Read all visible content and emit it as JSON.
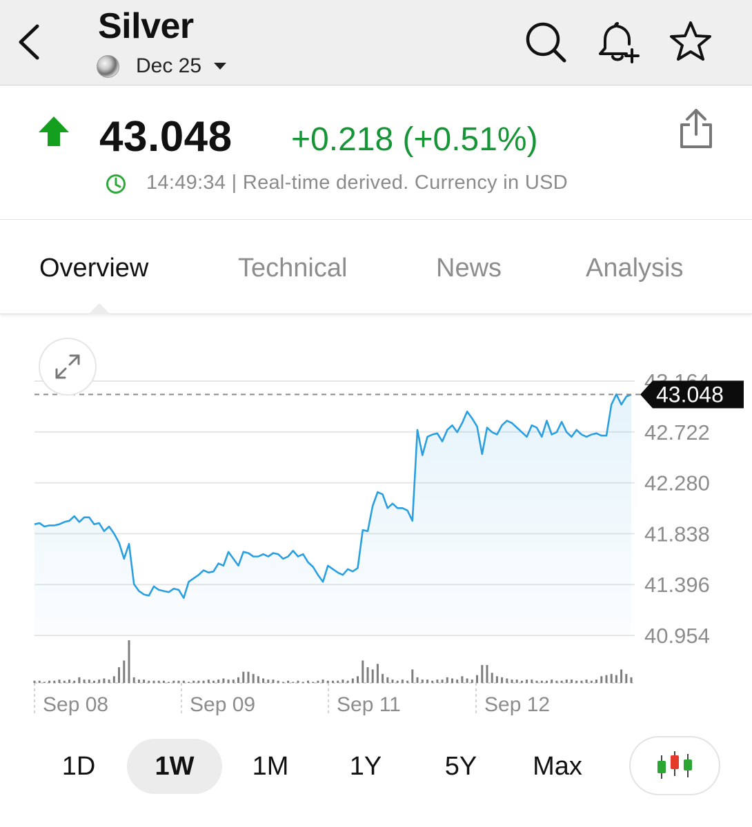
{
  "header": {
    "title": "Silver",
    "contract_label": "Dec 25"
  },
  "quote": {
    "price": "43.048",
    "change": "+0.218 (+0.51%)",
    "status": "14:49:34 | Real-time derived. Currency in USD",
    "change_color": "#159536"
  },
  "tabs": [
    {
      "label": "Overview"
    },
    {
      "label": "Technical"
    },
    {
      "label": "News"
    },
    {
      "label": "Analysis"
    }
  ],
  "ranges": [
    {
      "label": "1D"
    },
    {
      "label": "1W"
    },
    {
      "label": "1M"
    },
    {
      "label": "1Y"
    },
    {
      "label": "5Y"
    },
    {
      "label": "Max"
    }
  ],
  "icons": [
    "chevron-left-icon",
    "search-icon",
    "bell-plus-icon",
    "star-icon",
    "share-icon",
    "clock-icon",
    "expand-icon",
    "candlestick-icon"
  ],
  "chart_data": {
    "type": "area",
    "line_color": "#2a9fe0",
    "ylim": [
      40.954,
      43.164
    ],
    "y_ticks": [
      "43.164",
      "42.722",
      "42.280",
      "41.838",
      "41.396",
      "40.954"
    ],
    "current_value_label": "43.048",
    "current_value": 43.048,
    "x_labels": [
      "Sep 08",
      "Sep 09",
      "Sep 11",
      "Sep 12"
    ],
    "series": [
      {
        "values": [
          41.92,
          41.93,
          41.9,
          41.91,
          41.91,
          41.92,
          41.94,
          41.95,
          41.99,
          41.94,
          41.98,
          41.98,
          41.92,
          41.93,
          41.86,
          41.9,
          41.84,
          41.76,
          41.62,
          41.75,
          41.4,
          41.34,
          41.31,
          41.3,
          41.38,
          41.35,
          41.34,
          41.33,
          41.36,
          41.35,
          41.28,
          41.42,
          41.45,
          41.48,
          41.52,
          41.5,
          41.51,
          41.58,
          41.56,
          41.68,
          41.62,
          41.56,
          41.68,
          41.67,
          41.64,
          41.64,
          41.66,
          41.64,
          41.67,
          41.66,
          41.62,
          41.64,
          41.69,
          41.64,
          41.66,
          41.59,
          41.55,
          41.48,
          41.42,
          41.56,
          41.53,
          41.5,
          41.48,
          41.53,
          41.51,
          41.54,
          41.87,
          41.86,
          42.08,
          42.2,
          42.18,
          42.06,
          42.1,
          42.06,
          42.06,
          42.04,
          41.95,
          42.74,
          42.52,
          42.68,
          42.7,
          42.71,
          42.64,
          42.74,
          42.78,
          42.72,
          42.8,
          42.9,
          42.84,
          42.77,
          42.53,
          42.76,
          42.72,
          42.7,
          42.78,
          42.82,
          42.8,
          42.76,
          42.72,
          42.68,
          42.78,
          42.76,
          42.68,
          42.82,
          42.7,
          42.72,
          42.81,
          42.72,
          42.68,
          42.74,
          42.7,
          42.68,
          42.7,
          42.71,
          42.69,
          42.69,
          42.96,
          43.05,
          42.96,
          43.03,
          43.048
        ]
      }
    ],
    "volume": [
      2,
      2,
      1,
      2,
      2,
      3,
      2,
      3,
      2,
      5,
      3,
      3,
      2,
      3,
      4,
      3,
      6,
      14,
      20,
      38,
      5,
      3,
      3,
      2,
      2,
      2,
      2,
      1,
      2,
      2,
      2,
      1,
      2,
      2,
      2,
      3,
      2,
      3,
      4,
      3,
      3,
      5,
      10,
      10,
      8,
      6,
      4,
      3,
      3,
      2,
      1,
      2,
      1,
      2,
      1,
      2,
      1,
      2,
      3,
      2,
      2,
      2,
      3,
      2,
      4,
      6,
      20,
      14,
      12,
      17,
      8,
      5,
      3,
      2,
      3,
      2,
      12,
      5,
      3,
      3,
      2,
      3,
      3,
      5,
      4,
      3,
      6,
      4,
      3,
      7,
      16,
      16,
      9,
      6,
      5,
      4,
      3,
      3,
      2,
      3,
      3,
      2,
      2,
      2,
      3,
      2,
      2,
      3,
      3,
      2,
      2,
      3,
      2,
      3,
      6,
      7,
      8,
      7,
      12,
      8,
      5
    ]
  }
}
